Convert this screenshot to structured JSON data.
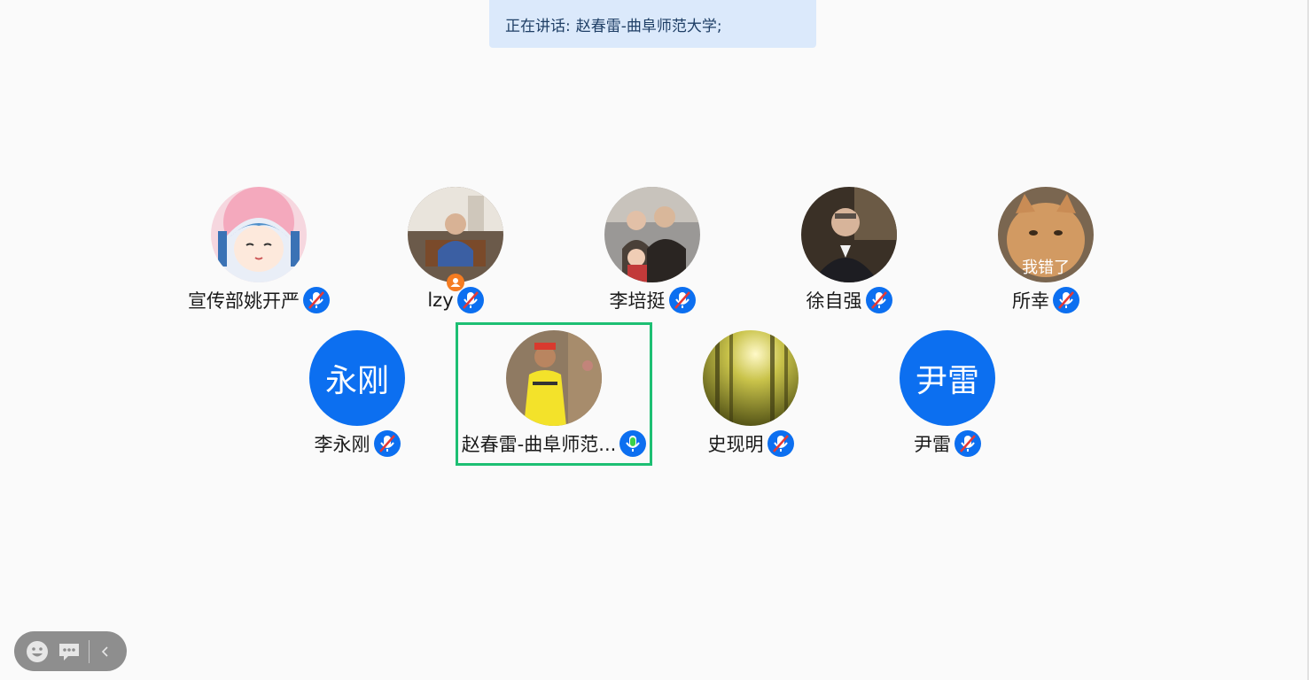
{
  "banner": {
    "label": "正在讲话:",
    "speakers": "赵春雷-曲阜师范大学;"
  },
  "colors": {
    "accent": "#0c6ff0",
    "speaking_border": "#1dbf73",
    "banner_bg": "#dbe9fb",
    "mic_speaking": "#3ad14b"
  },
  "participants": [
    {
      "name": "宣传部姚开严",
      "avatar_type": "anime-illustration",
      "mic": "muted"
    },
    {
      "name": "lzy",
      "avatar_type": "photo",
      "mic": "muted",
      "badge": "host-icon"
    },
    {
      "name": "李培挺",
      "avatar_type": "photo",
      "mic": "muted"
    },
    {
      "name": "徐自强",
      "avatar_type": "photo",
      "mic": "muted"
    },
    {
      "name": "所幸",
      "avatar_type": "photo",
      "avatar_caption": "我错了",
      "mic": "muted"
    },
    {
      "name": "李永刚",
      "avatar_type": "text",
      "avatar_text": "永刚",
      "mic": "muted"
    },
    {
      "name": "赵春雷-曲阜师范...",
      "avatar_type": "photo",
      "mic": "speaking",
      "active_speaker": true
    },
    {
      "name": "史现明",
      "avatar_type": "forest-image",
      "mic": "muted"
    },
    {
      "name": "尹雷",
      "avatar_type": "text",
      "avatar_text": "尹雷",
      "mic": "muted"
    }
  ],
  "toolbar": {
    "icons": [
      "emoji-icon",
      "chat-icon",
      "collapse-chevron-icon"
    ]
  }
}
